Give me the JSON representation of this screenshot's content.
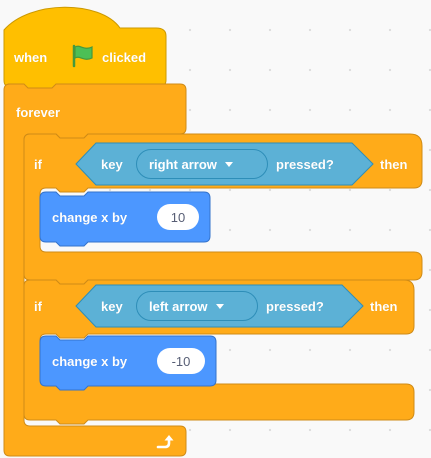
{
  "script": {
    "hat_block": {
      "label_before": "when",
      "label_after": "clicked",
      "icon": "green-flag-icon"
    },
    "forever_block": {
      "label": "forever",
      "end_icon": "loop-arrow-icon"
    },
    "if_blocks": [
      {
        "if_label": "if",
        "then_label": "then",
        "condition": {
          "label_before": "key",
          "key_option": "right arrow",
          "label_after": "pressed?"
        },
        "action": {
          "label": "change x by",
          "value": "10"
        }
      },
      {
        "if_label": "if",
        "then_label": "then",
        "condition": {
          "label_before": "key",
          "key_option": "left arrow",
          "label_after": "pressed?"
        },
        "action": {
          "label": "change x by",
          "value": "-10"
        }
      }
    ]
  },
  "colors": {
    "events_fill": "#ffbf00",
    "control_fill": "#ffab19",
    "control_stroke": "#cf8b17",
    "sensing_fill": "#5cb1d6",
    "sensing_stroke": "#2e8eb8",
    "motion_fill": "#4c97ff",
    "motion_stroke": "#3373cc",
    "flag_green": "#4cbf56"
  }
}
